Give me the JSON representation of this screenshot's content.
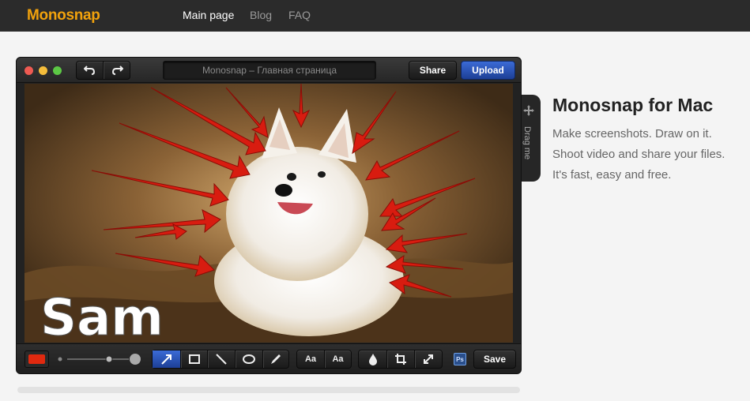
{
  "nav": {
    "logo": "Monosnap",
    "links": [
      {
        "label": "Main page",
        "active": true
      },
      {
        "label": "Blog",
        "active": false
      },
      {
        "label": "FAQ",
        "active": false
      }
    ]
  },
  "window": {
    "title": "Monosnap – Главная страница",
    "share_label": "Share",
    "upload_label": "Upload",
    "drag_label": "Drag me",
    "canvas_caption": "Sam",
    "toolbar": {
      "color": "#e0290f",
      "text_tool_label": "Aa",
      "text_bg_tool_label": "Aa",
      "photoshop_label": "Ps",
      "save_label": "Save"
    }
  },
  "promo": {
    "title": "Monosnap for Mac",
    "lines": [
      "Make screenshots. Draw on it.",
      "Shoot video and share your files.",
      "It's fast, easy and free."
    ]
  },
  "colors": {
    "brand": "#f2a20c",
    "accent_blue": "#2d5fcf",
    "annotation_red": "#e0290f"
  }
}
